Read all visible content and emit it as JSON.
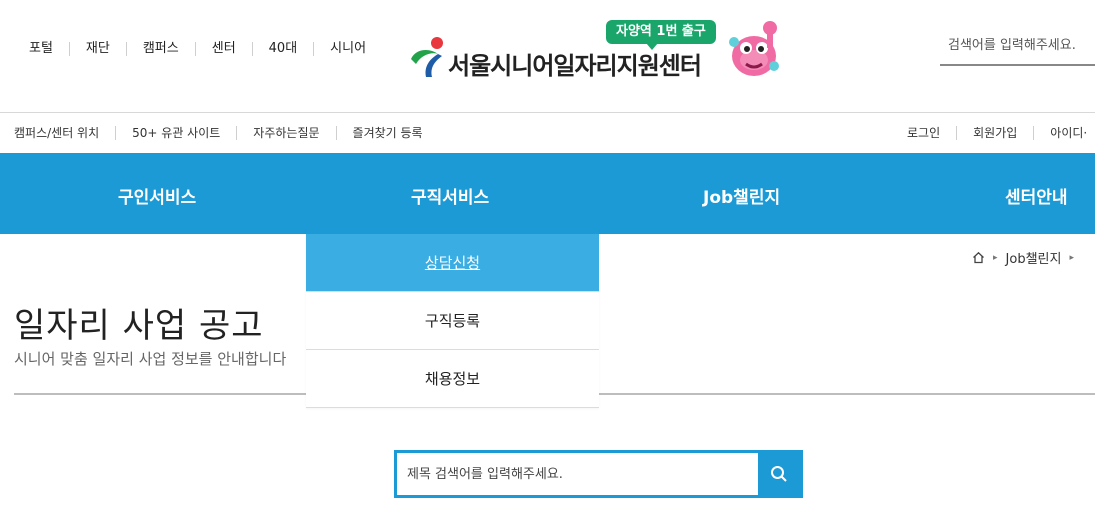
{
  "portal_links": [
    "포털",
    "재단",
    "캠퍼스",
    "센터",
    "40대",
    "시니어"
  ],
  "logo": {
    "text": "서울시니어일자리지원센터",
    "badge": "자양역 1번 출구"
  },
  "top_search": {
    "placeholder": "검색어를 입력해주세요."
  },
  "util_left": [
    "캠퍼스/센터 위치",
    "50+ 유관 사이트",
    "자주하는질문",
    "즐겨찾기 등록"
  ],
  "util_right": [
    "로그인",
    "회원가입",
    "아이디·"
  ],
  "gnb": [
    "구인서비스",
    "구직서비스",
    "Job챌린지",
    "센터안내"
  ],
  "dropdown": [
    {
      "label": "상담신청",
      "active": true
    },
    {
      "label": "구직등록",
      "active": false
    },
    {
      "label": "채용정보",
      "active": false
    }
  ],
  "breadcrumb": {
    "home_icon": "home-icon",
    "items": [
      "Job챌린지"
    ]
  },
  "page": {
    "title": "일자리 사업 공고",
    "description": "시니어 맞춤 일자리 사업 정보를 안내합니다"
  },
  "main_search": {
    "placeholder": "제목 검색어를 입력해주세요.",
    "button_icon": "search-icon"
  },
  "colors": {
    "primary": "#1c9ad6",
    "active_menu": "#3aaee3",
    "badge": "#1aa66a"
  }
}
